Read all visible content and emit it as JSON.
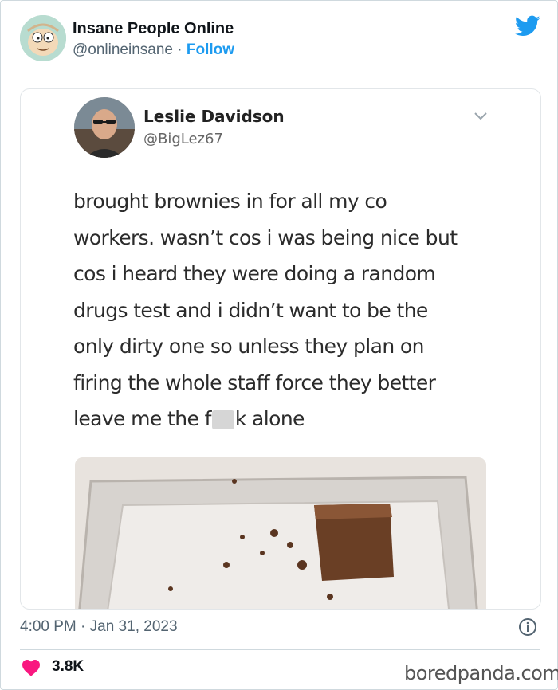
{
  "author": {
    "name": "Insane People Online",
    "handle": "@onlineinsane",
    "separator": "·",
    "follow_label": "Follow"
  },
  "embedded_tweet": {
    "name": "Leslie Davidson",
    "handle": "@BigLez67",
    "text_lines": [
      "brought brownies in for all my co",
      "workers. wasn’t cos i was being nice but",
      "cos i heard they were doing a random",
      "drugs test and i didn’t want to be the",
      "only dirty one so unless they plan on",
      "firing the whole staff force they better"
    ],
    "last_line_start": "leave me the f",
    "last_line_end": "k alone"
  },
  "timestamp": "4:00 PM · Jan 31, 2023",
  "likes": "3.8K",
  "watermark": "boredpanda.com",
  "colors": {
    "accent": "#1d9bf0",
    "heart": "#f91880",
    "muted": "#536471"
  },
  "icons": [
    "twitter-bird-icon",
    "chevron-down-icon",
    "info-icon",
    "heart-icon"
  ]
}
